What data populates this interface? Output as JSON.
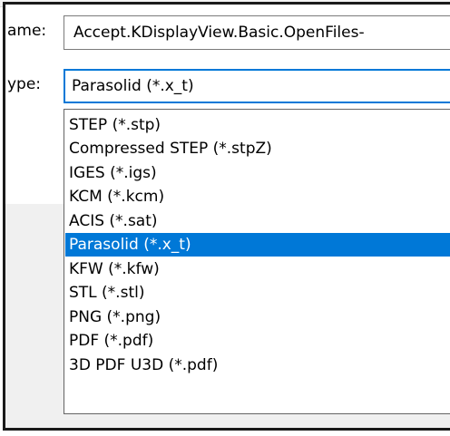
{
  "file_name_label": "ame:",
  "file_name_value": "Accept.KDisplayView.Basic.OpenFiles-",
  "file_type_label": "ype:",
  "file_type_selected": "Parasolid (*.x_t)",
  "file_type_options": [
    "STEP (*.stp)",
    "Compressed STEP (*.stpZ)",
    "IGES (*.igs)",
    "KCM (*.kcm)",
    "ACIS (*.sat)",
    "Parasolid (*.x_t)",
    "KFW (*.kfw)",
    "STL (*.stl)",
    "PNG (*.png)",
    "PDF (*.pdf)",
    "3D PDF U3D (*.pdf)"
  ],
  "highlighted_option": "Parasolid (*.x_t)",
  "colors": {
    "accent": "#0078d7",
    "frame": "#1a1a1a",
    "dialog_background": "#f0f0f0"
  }
}
